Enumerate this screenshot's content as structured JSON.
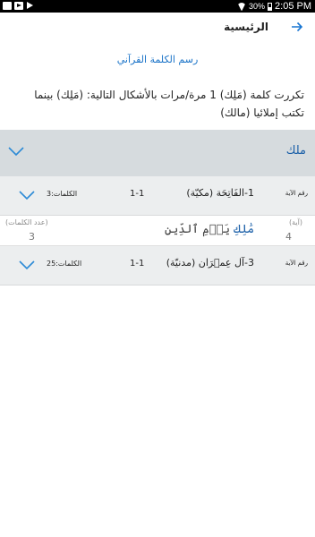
{
  "status_bar": {
    "battery": "30%",
    "time": "2:05 PM"
  },
  "app_bar": {
    "title": "الرئيسية",
    "back_icon": "arrow-right-icon"
  },
  "section_title": "رسم الكلمة القرآني",
  "summary": "تكررت كلمة (مَلِك) 1 مرة/مرات بالأشكال التالية: (مَلِك) بينما تكتب إملائيا (مالك)",
  "word_group": {
    "word": "ملك",
    "chevron_icon": "chevron-down-icon"
  },
  "rows": [
    {
      "ayah_label": "رقم الآية",
      "surah": "1-الفَاتِحَة (مكيّة)",
      "range": "1-1",
      "words": "الكلمات:3",
      "chevron_icon": "chevron-down-icon",
      "detail": {
        "ayah_number_label": "(آية)",
        "ayah_number": "4",
        "word_count_label": "(عدد الكلمات)",
        "word_count": "3",
        "ayah_highlight": "مَٰلِكِ",
        "ayah_rest": " يَوۡمِ ٱلدِّينِ"
      }
    },
    {
      "ayah_label": "رقم الآية",
      "surah": "3-آل عِمۡرَان (مدنيّة)",
      "range": "1-1",
      "words": "الكلمات:25",
      "chevron_icon": "chevron-down-icon"
    }
  ],
  "colors": {
    "accent": "#1a73c8",
    "header_bg": "#d6dbde",
    "row_bg": "#eceeef"
  }
}
